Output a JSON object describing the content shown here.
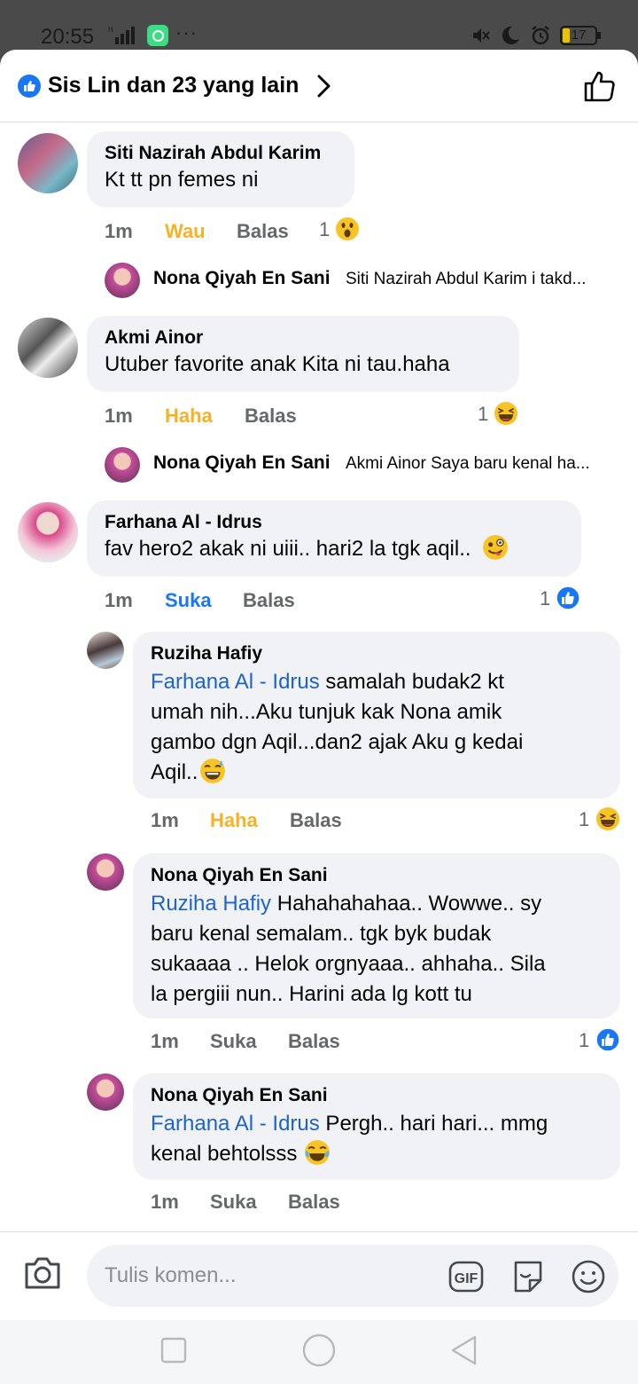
{
  "status_bar": {
    "time": "20:55",
    "battery": "17"
  },
  "header": {
    "title": "Sis Lin dan 23 yang lain"
  },
  "comments": [
    {
      "author": "Siti Nazirah Abdul Karim",
      "text": "Kt tt pn femes ni",
      "time": "1m",
      "reaction": "Wau",
      "reply": "Balas",
      "count": "1",
      "reply_preview": {
        "author": "Nona Qiyah En Sani",
        "text": "Siti Nazirah Abdul Karim i takd..."
      }
    },
    {
      "author": "Akmi Ainor",
      "text": "Utuber favorite anak Kita ni tau.haha",
      "time": "1m",
      "reaction": "Haha",
      "reply": "Balas",
      "count": "1",
      "reply_preview": {
        "author": "Nona Qiyah En Sani",
        "text": "Akmi Ainor Saya baru kenal ha..."
      }
    },
    {
      "author": "Farhana Al - Idrus",
      "text": "fav hero2 akak ni uiii.. hari2 la tgk aqil..",
      "time": "1m",
      "reaction": "Suka",
      "reply": "Balas",
      "count": "1",
      "replies": [
        {
          "author": "Ruziha Hafiy",
          "mention": "Farhana Al - Idrus",
          "line1": " samalah budak2 kt",
          "line2": "umah nih...Aku tunjuk kak Nona amik",
          "line3": "gambo dgn Aqil...dan2 ajak Aku g kedai",
          "line4": "Aqil..",
          "time": "1m",
          "reaction": "Haha",
          "reply": "Balas",
          "count": "1"
        },
        {
          "author": "Nona Qiyah En Sani",
          "mention": "Ruziha Hafiy",
          "line1": " Hahahahahaa.. Wowwe.. sy",
          "line2": "baru kenal semalam.. tgk byk budak",
          "line3": "sukaaaa .. Helok orgnyaaa.. ahhaha.. Sila",
          "line4": "la pergiii nun.. Harini ada lg kott tu",
          "time": "1m",
          "reaction": "Suka",
          "reply": "Balas",
          "count": "1"
        },
        {
          "author": "Nona Qiyah En Sani",
          "mention": "Farhana Al - Idrus",
          "line1": " Pergh.. hari hari... mmg",
          "line2": "kenal behtolsss",
          "time": "1m",
          "reaction": "Suka",
          "reply": "Balas"
        }
      ]
    }
  ],
  "composer": {
    "placeholder": "Tulis komen...",
    "gif": "GIF"
  },
  "icons": {
    "header_badge": "like-icon",
    "header_chevron": "chevron-right-icon",
    "header_like": "thumbs-up-icon",
    "camera": "camera-icon",
    "gif": "gif-icon",
    "sticker": "sticker-icon",
    "emoji": "emoji-icon",
    "nav": [
      "recents-square-icon",
      "home-circle-icon",
      "back-triangle-icon"
    ]
  },
  "colors": {
    "accent": "#1877f2",
    "haha": "#f7b125",
    "bubble": "#f0f2f5",
    "mention": "#1e64c8"
  }
}
